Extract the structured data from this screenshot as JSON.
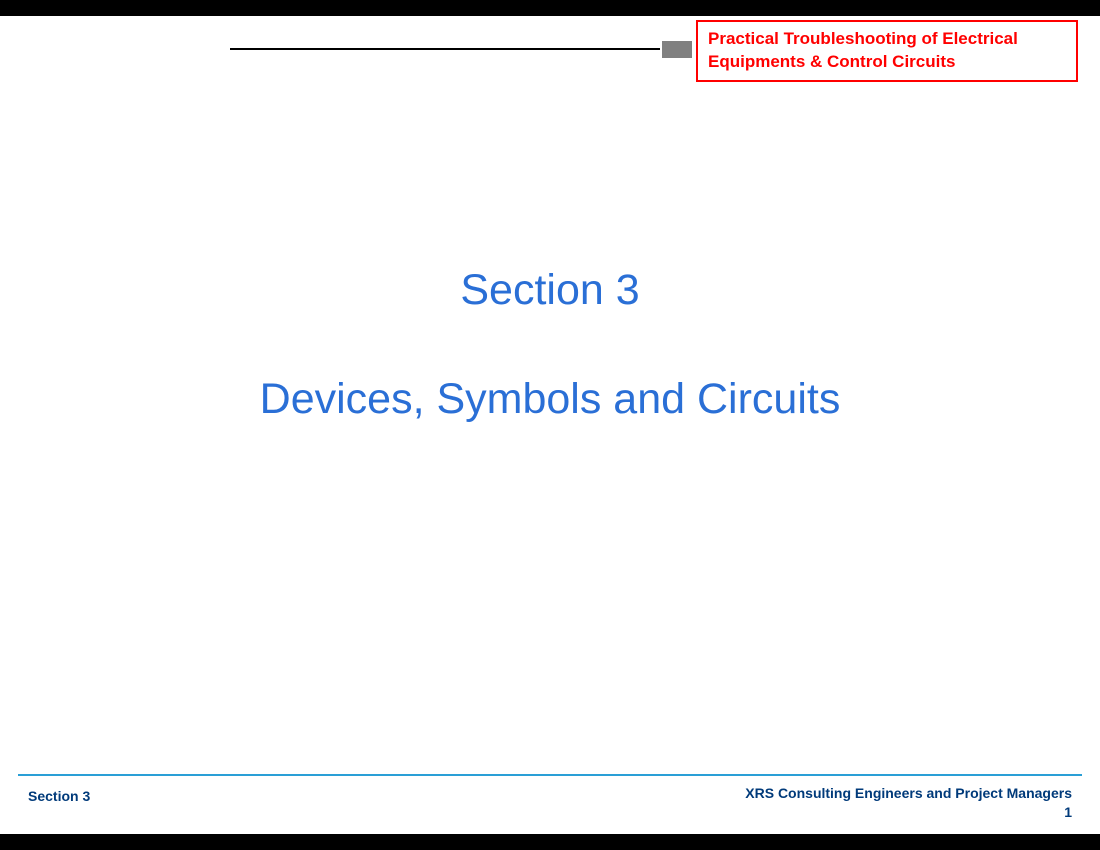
{
  "header": {
    "course_title": "Practical Troubleshooting of Electrical Equipments & Control Circuits"
  },
  "main": {
    "section_label": "Section 3",
    "section_title": "Devices, Symbols and Circuits"
  },
  "footer": {
    "left": "Section 3",
    "right": "XRS Consulting Engineers and Project Managers  1"
  }
}
